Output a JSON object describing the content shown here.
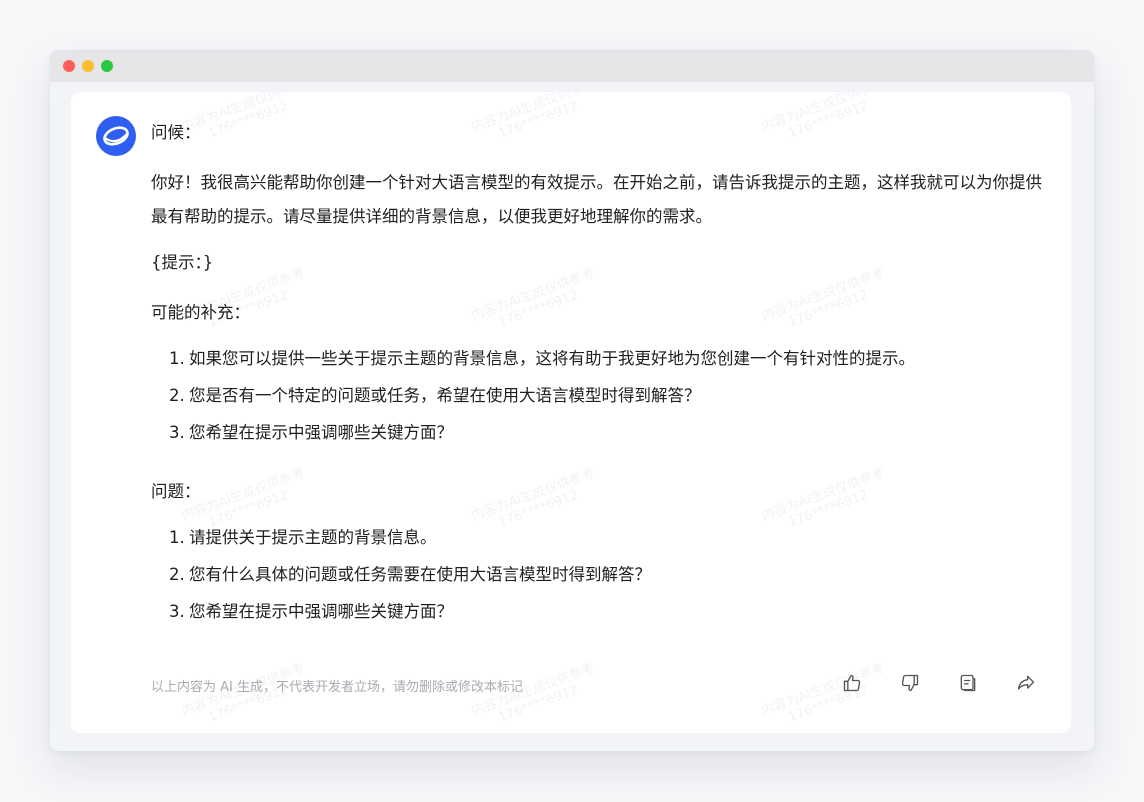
{
  "window": {
    "controls": {
      "close_color": "#ff5f57",
      "minimize_color": "#febc2e",
      "maximize_color": "#28c840"
    }
  },
  "message": {
    "avatar_icon": "assistant-logo-icon",
    "greeting_title": "问候：",
    "greeting_body": "你好！我很高兴能帮助你创建一个针对大语言模型的有效提示。在开始之前，请告诉我提示的主题，这样我就可以为你提供最有帮助的提示。请尽量提供详细的背景信息，以便我更好地理解你的需求。",
    "hint": "{提示：}",
    "supplement_title": "可能的补充：",
    "supplement_items": [
      {
        "num": "1.",
        "text": "如果您可以提供一些关于提示主题的背景信息，这将有助于我更好地为您创建一个有针对性的提示。"
      },
      {
        "num": "2.",
        "text": "您是否有一个特定的问题或任务，希望在使用大语言模型时得到解答？"
      },
      {
        "num": "3.",
        "text": "您希望在提示中强调哪些关键方面？"
      }
    ],
    "questions_title": "问题：",
    "question_items": [
      {
        "num": "1.",
        "text": "请提供关于提示主题的背景信息。"
      },
      {
        "num": "2.",
        "text": "您有什么具体的问题或任务需要在使用大语言模型时得到解答？"
      },
      {
        "num": "3.",
        "text": "您希望在提示中强调哪些关键方面？"
      }
    ],
    "footer_note": "以上内容为 AI 生成，不代表开发者立场，请勿删除或修改本标记"
  },
  "actions": [
    "thumbs-up-icon",
    "thumbs-down-icon",
    "copy-icon",
    "share-icon"
  ],
  "watermark": {
    "line1": "内容为AI生成仅供参考",
    "line2": "176****6912"
  },
  "colors": {
    "accent": "#2f5ff0",
    "text": "#1f1f1f",
    "muted": "#a9abb1"
  }
}
